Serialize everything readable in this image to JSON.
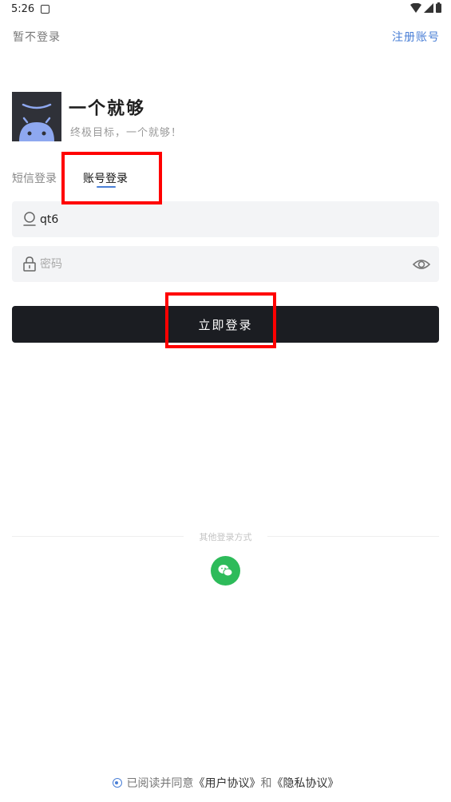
{
  "status_bar": {
    "time": "5:26"
  },
  "header": {
    "skip_label": "暂不登录",
    "register_label": "注册账号"
  },
  "brand": {
    "app_name": "一个就够",
    "tagline": "终极目标，一个就够！"
  },
  "tabs": [
    {
      "label": "短信登录",
      "selected": false
    },
    {
      "label": "账号登录",
      "selected": true
    }
  ],
  "form": {
    "username_value": "qt6",
    "password_placeholder": "密码"
  },
  "login_button_label": "立即登录",
  "other_login": {
    "label": "其他登录方式",
    "icon": "wechat-icon"
  },
  "agreement": {
    "prefix": "已阅读并同意",
    "user_agreement": "《用户协议》",
    "conjunction": "和",
    "privacy_policy": "《隐私协议》"
  },
  "colors": {
    "accent": "#4a7fd6",
    "button": "#1b1d22",
    "wechat": "#2dbb5a",
    "highlight": "#ff0000"
  }
}
